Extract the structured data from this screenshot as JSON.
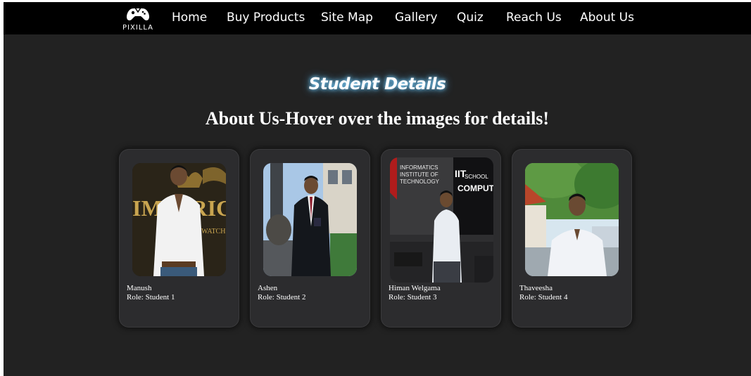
{
  "nav": {
    "logo_text": "PIXILLA",
    "links": [
      "Home",
      "Buy Products",
      "Site Map",
      "Gallery",
      "Quiz",
      "Reach Us",
      "About Us"
    ]
  },
  "main": {
    "section_title": "Student Details",
    "headline": "About Us-Hover over the images for details!"
  },
  "students": [
    {
      "name": "Manush",
      "role": "Role: Student 1"
    },
    {
      "name": "Ashen",
      "role": "Role: Student 2"
    },
    {
      "name": "Himan Welgama",
      "role": "Role: Student 3"
    },
    {
      "name": "Thaveesha",
      "role": "Role: Student 4"
    }
  ],
  "photo_texts": {
    "p1_banner": "IMPERIC",
    "p1_banner_sub": "WATCH",
    "p3_sign_left": "INFORMATICS INSTITUTE OF TECHNOLOGY",
    "p3_sign_right": "SCHOOL",
    "p3_sign_right_big": "COMPUTI"
  },
  "colors": {
    "page_bg": "#222222",
    "navbar_bg": "#000000",
    "card_bg": "#2c2c2e",
    "glow": "#7fd3ff"
  }
}
